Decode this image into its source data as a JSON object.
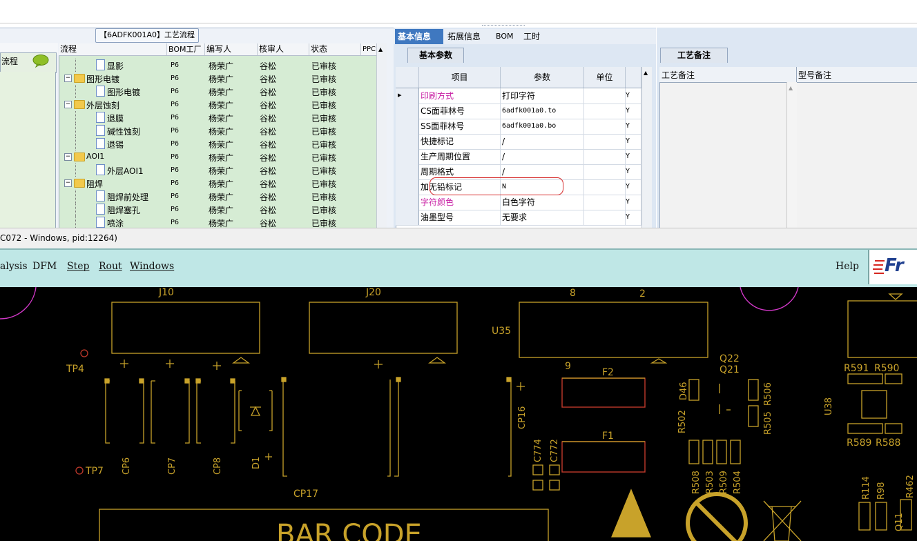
{
  "left_panel": {
    "tab_title": "【6ADFK001A0】工艺流程",
    "side_label": "流程",
    "columns": [
      "流程",
      "BOM工厂",
      "编写人",
      "核审人",
      "状态",
      "PPC"
    ],
    "rows": [
      {
        "name": "显影",
        "level": 2,
        "kind": "doc",
        "bom": "P6",
        "writer": "杨荣广",
        "reviewer": "谷松",
        "status": "已审核"
      },
      {
        "name": "图形电镀",
        "level": 1,
        "kind": "folder",
        "bom": "P6",
        "writer": "杨荣广",
        "reviewer": "谷松",
        "status": "已审核"
      },
      {
        "name": "图形电镀",
        "level": 2,
        "kind": "doc",
        "bom": "P6",
        "writer": "杨荣广",
        "reviewer": "谷松",
        "status": "已审核"
      },
      {
        "name": "外层蚀刻",
        "level": 1,
        "kind": "folder",
        "bom": "P6",
        "writer": "杨荣广",
        "reviewer": "谷松",
        "status": "已审核"
      },
      {
        "name": "退膜",
        "level": 2,
        "kind": "doc",
        "bom": "P6",
        "writer": "杨荣广",
        "reviewer": "谷松",
        "status": "已审核"
      },
      {
        "name": "碱性蚀刻",
        "level": 2,
        "kind": "doc",
        "bom": "P6",
        "writer": "杨荣广",
        "reviewer": "谷松",
        "status": "已审核"
      },
      {
        "name": "退锡",
        "level": 2,
        "kind": "doc",
        "bom": "P6",
        "writer": "杨荣广",
        "reviewer": "谷松",
        "status": "已审核"
      },
      {
        "name": "AOI1",
        "level": 1,
        "kind": "folder",
        "bom": "P6",
        "writer": "杨荣广",
        "reviewer": "谷松",
        "status": "已审核"
      },
      {
        "name": "外层AOI1",
        "level": 2,
        "kind": "doc",
        "bom": "P6",
        "writer": "杨荣广",
        "reviewer": "谷松",
        "status": "已审核"
      },
      {
        "name": "阻焊",
        "level": 1,
        "kind": "folder",
        "bom": "P6",
        "writer": "杨荣广",
        "reviewer": "谷松",
        "status": "已审核"
      },
      {
        "name": "阻焊前处理",
        "level": 2,
        "kind": "doc",
        "bom": "P6",
        "writer": "杨荣广",
        "reviewer": "谷松",
        "status": "已审核"
      },
      {
        "name": "阻焊塞孔",
        "level": 2,
        "kind": "doc",
        "bom": "P6",
        "writer": "杨荣广",
        "reviewer": "谷松",
        "status": "已审核"
      },
      {
        "name": "喷涂",
        "level": 2,
        "kind": "doc",
        "bom": "P6",
        "writer": "杨荣广",
        "reviewer": "谷松",
        "status": "已审核"
      }
    ]
  },
  "middle_panel": {
    "tabs": [
      "基本信息",
      "拓展信息",
      "BOM",
      "工时"
    ],
    "subtab": "基本参数",
    "columns": [
      "项目",
      "参数",
      "单位"
    ],
    "rows": [
      {
        "item": "印刷方式",
        "value": "打印字符",
        "flag": "Y",
        "highlight": "#c81fa4",
        "current": true
      },
      {
        "item": "CS面菲林号",
        "value": "6adfk001a0.to",
        "flag": "Y",
        "mono": true
      },
      {
        "item": "SS面菲林号",
        "value": "6adfk001a0.bo",
        "flag": "Y",
        "mono": true
      },
      {
        "item": "快捷标记",
        "value": "/",
        "flag": "Y"
      },
      {
        "item": "生产周期位置",
        "value": "/",
        "flag": "Y"
      },
      {
        "item": "周期格式",
        "value": "/",
        "flag": "Y"
      },
      {
        "item": "加无铅标记",
        "value": "N",
        "flag": "Y"
      },
      {
        "item": "字符颜色",
        "value": "白色字符",
        "flag": "Y",
        "highlight": "#c81fa4"
      },
      {
        "item": "油墨型号",
        "value": "无要求",
        "flag": "Y"
      }
    ]
  },
  "right_panel": {
    "tab": "工艺备注",
    "columns": [
      "工艺备注",
      "型号备注"
    ]
  },
  "status_line": "C072 - Windows, pid:12264)",
  "menu": {
    "items": [
      {
        "label": "alysis"
      },
      {
        "label": "DFM"
      },
      {
        "label": "Step"
      },
      {
        "label": "Rout"
      },
      {
        "label": "Windows"
      }
    ],
    "help": "Help",
    "logo_text": "Fr"
  },
  "pcb": {
    "labels": [
      "J10",
      "J20",
      "U35",
      "8",
      "2",
      "9",
      "TP4",
      "TP7",
      "CP6",
      "CP7",
      "CP8",
      "D1",
      "CP16",
      "CP17",
      "C774",
      "C772",
      "F2",
      "F1",
      "Q22",
      "Q21",
      "D46",
      "R506",
      "R505",
      "R502",
      "R508",
      "R503",
      "R509",
      "R504",
      "U38",
      "R591",
      "R590",
      "R589",
      "R588",
      "R114",
      "R98",
      "R462",
      "Q11",
      "BAR CODE"
    ],
    "colors": {
      "trace": "#c8a22a",
      "circle": "#d238c8",
      "red": "#c0392b",
      "background": "#000000"
    }
  }
}
